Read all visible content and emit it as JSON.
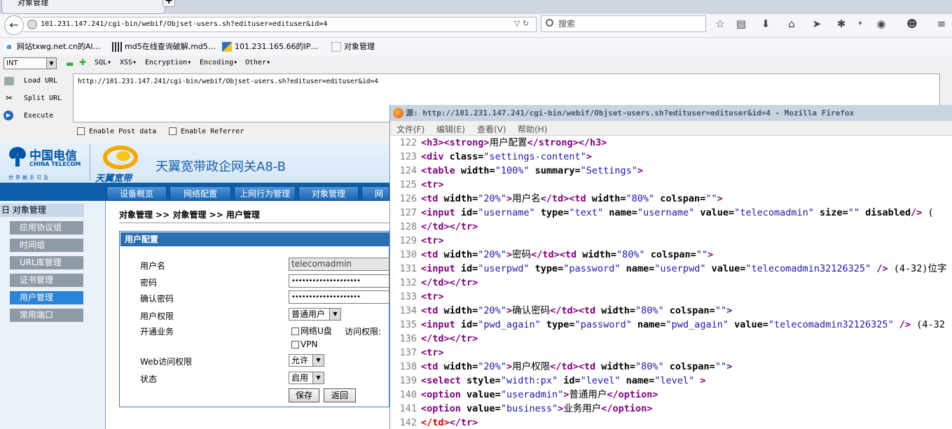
{
  "browser": {
    "tab_title": "对象管理",
    "url": "101.231.147.241/cgi-bin/webif/Objset-users.sh?edituser=edituser&id=4",
    "search_placeholder": "搜索",
    "bookmarks": [
      {
        "label": "网站txwg.net.cn的Al…"
      },
      {
        "label": "md5在线查询破解,md5…"
      },
      {
        "label": "101.231.165.66的IP…"
      },
      {
        "label": "对象管理"
      }
    ]
  },
  "hackbar": {
    "type_value": "INT",
    "menus": [
      "SQL▾",
      "XSS▾",
      "Encryption▾",
      "Encoding▾",
      "Other▾"
    ],
    "load_url": "Load URL",
    "split_url": "Split URL",
    "execute": "Execute",
    "url_value": "http://101.231.147.241/cgi-bin/webif/Objset-users.sh?edituser=edituser&id=4",
    "enable_post": "Enable Post data",
    "enable_referrer": "Enable Referrer"
  },
  "webpage": {
    "brand_cn": "中国电信",
    "brand_en": "CHINA TELECOM",
    "slogan": "世界触手可及",
    "ty_brand": "天翼宽带",
    "product_title": "天翼宽带政企网关A8-B",
    "nav_tabs": [
      "设备概览",
      "网络配置",
      "上网行为管理",
      "对象管理",
      "网络"
    ],
    "menu_head": "日 对象管理",
    "menu_items": [
      "应用协议组",
      "时间组",
      "URL库管理",
      "证书管理",
      "用户管理",
      "常用端口"
    ],
    "breadcrumb": "对象管理 >> 对象管理 >> 用户管理",
    "panel_title": "用户配置",
    "form": {
      "username_label": "用户名",
      "username_value": "telecomadmin",
      "password_label": "密码",
      "password_value": "••••••••••••••••••••",
      "confirm_label": "确认密码",
      "confirm_value": "••••••••••••••••••••",
      "level_label": "用户权限",
      "level_value": "普通用户",
      "service_label": "开通业务",
      "service_usb": "网络U盘",
      "access_label": "访问权限:",
      "service_vpn": "VPN",
      "web_label": "Web访问权限",
      "web_value": "允许",
      "status_label": "状态",
      "status_value": "启用",
      "save": "保存",
      "back": "返回"
    }
  },
  "viewsource": {
    "title": "源: http://101.231.147.241/cgi-bin/webif/Objset-users.sh?edituser=edituser&id=4 - Mozilla Firefox",
    "menus": [
      "文件(F)",
      "编辑(E)",
      "查看(V)",
      "帮助(H)"
    ],
    "lines": [
      {
        "n": "122",
        "code": [
          [
            "t",
            "<h3>"
          ],
          [
            "t",
            "<strong>"
          ],
          [
            "tx",
            "用户配置"
          ],
          [
            "t",
            "</strong>"
          ],
          [
            "t",
            "</h3>"
          ]
        ]
      },
      {
        "n": "123",
        "code": [
          [
            "t",
            "<div "
          ],
          [
            "an",
            "class="
          ],
          [
            "av",
            "\"settings-content\""
          ],
          [
            "t",
            ">"
          ]
        ]
      },
      {
        "n": "124",
        "code": [
          [
            "t",
            "<table "
          ],
          [
            "an",
            "width="
          ],
          [
            "av",
            "\"100%\""
          ],
          [
            "an",
            " summary="
          ],
          [
            "av",
            "\"Settings\""
          ],
          [
            "t",
            ">"
          ]
        ]
      },
      {
        "n": "125",
        "code": [
          [
            "t",
            "<tr>"
          ]
        ]
      },
      {
        "n": "126",
        "code": [
          [
            "t",
            "<td "
          ],
          [
            "an",
            "width="
          ],
          [
            "av",
            "\"20%\""
          ],
          [
            "t",
            ">"
          ],
          [
            "tx",
            "用户名"
          ],
          [
            "t",
            "</td>"
          ],
          [
            "t",
            "<td "
          ],
          [
            "an",
            "width="
          ],
          [
            "av",
            "\"80%\""
          ],
          [
            "an",
            " colspan="
          ],
          [
            "av",
            "\"\""
          ],
          [
            "t",
            ">"
          ]
        ]
      },
      {
        "n": "127",
        "code": [
          [
            "t",
            "<input "
          ],
          [
            "an",
            "id="
          ],
          [
            "av",
            "\"username\""
          ],
          [
            "an",
            " type="
          ],
          [
            "av",
            "\"text\""
          ],
          [
            "an",
            " name="
          ],
          [
            "av",
            "\"username\""
          ],
          [
            "an",
            " value="
          ],
          [
            "av",
            "\"telecomadmin\""
          ],
          [
            "an",
            " size="
          ],
          [
            "av",
            "\"\""
          ],
          [
            "an",
            " disabled"
          ],
          [
            "t",
            "/>"
          ],
          [
            "tx",
            " ("
          ]
        ]
      },
      {
        "n": "128",
        "code": [
          [
            "t",
            "</td>"
          ],
          [
            "t",
            "</tr>"
          ]
        ]
      },
      {
        "n": "129",
        "code": [
          [
            "t",
            "<tr>"
          ]
        ]
      },
      {
        "n": "130",
        "code": [
          [
            "t",
            "<td "
          ],
          [
            "an",
            "width="
          ],
          [
            "av",
            "\"20%\""
          ],
          [
            "t",
            ">"
          ],
          [
            "tx",
            "密码"
          ],
          [
            "t",
            "</td>"
          ],
          [
            "t",
            "<td "
          ],
          [
            "an",
            "width="
          ],
          [
            "av",
            "\"80%\""
          ],
          [
            "an",
            " colspan="
          ],
          [
            "av",
            "\"\""
          ],
          [
            "t",
            ">"
          ]
        ]
      },
      {
        "n": "131",
        "code": [
          [
            "t",
            "<input "
          ],
          [
            "an",
            "id="
          ],
          [
            "av",
            "\"userpwd\""
          ],
          [
            "an",
            " type="
          ],
          [
            "av",
            "\"password\""
          ],
          [
            "an",
            " name="
          ],
          [
            "av",
            "\"userpwd\""
          ],
          [
            "an",
            " value="
          ],
          [
            "av",
            "\"telecomadmin32126325\""
          ],
          [
            "t",
            " />"
          ],
          [
            "tx",
            " (4-32)位字"
          ]
        ]
      },
      {
        "n": "132",
        "code": [
          [
            "t",
            "</td>"
          ],
          [
            "t",
            "</tr>"
          ]
        ]
      },
      {
        "n": "133",
        "code": [
          [
            "t",
            "<tr>"
          ]
        ]
      },
      {
        "n": "134",
        "code": [
          [
            "t",
            "<td "
          ],
          [
            "an",
            "width="
          ],
          [
            "av",
            "\"20%\""
          ],
          [
            "t",
            ">"
          ],
          [
            "tx",
            "确认密码"
          ],
          [
            "t",
            "</td>"
          ],
          [
            "t",
            "<td "
          ],
          [
            "an",
            "width="
          ],
          [
            "av",
            "\"80%\""
          ],
          [
            "an",
            " colspan="
          ],
          [
            "av",
            "\"\""
          ],
          [
            "t",
            ">"
          ]
        ]
      },
      {
        "n": "135",
        "code": [
          [
            "t",
            "<input "
          ],
          [
            "an",
            "id="
          ],
          [
            "av",
            "\"pwd_again\""
          ],
          [
            "an",
            " type="
          ],
          [
            "av",
            "\"password\""
          ],
          [
            "an",
            " name="
          ],
          [
            "av",
            "\"pwd_again\""
          ],
          [
            "an",
            " value="
          ],
          [
            "av",
            "\"telecomadmin32126325\""
          ],
          [
            "t",
            " />"
          ],
          [
            "tx",
            " (4-32"
          ]
        ]
      },
      {
        "n": "136",
        "code": [
          [
            "t",
            "</td>"
          ],
          [
            "t",
            "</tr>"
          ]
        ]
      },
      {
        "n": "137",
        "code": [
          [
            "t",
            "<tr>"
          ]
        ]
      },
      {
        "n": "138",
        "code": [
          [
            "t",
            "<td "
          ],
          [
            "an",
            "width="
          ],
          [
            "av",
            "\"20%\""
          ],
          [
            "t",
            ">"
          ],
          [
            "tx",
            "用户权限"
          ],
          [
            "t",
            "</td>"
          ],
          [
            "t",
            "<td "
          ],
          [
            "an",
            "width="
          ],
          [
            "av",
            "\"80%\""
          ],
          [
            "an",
            " colspan="
          ],
          [
            "av",
            "\"\""
          ],
          [
            "t",
            ">"
          ]
        ]
      },
      {
        "n": "139",
        "code": [
          [
            "t",
            "<select "
          ],
          [
            "an",
            "style="
          ],
          [
            "av",
            "\"width:px\""
          ],
          [
            "an",
            " id="
          ],
          [
            "av",
            "\"level\""
          ],
          [
            "an",
            " name="
          ],
          [
            "av",
            "\"level\""
          ],
          [
            "t",
            " >"
          ]
        ]
      },
      {
        "n": "140",
        "code": [
          [
            "t",
            "<option "
          ],
          [
            "an",
            " value="
          ],
          [
            "av",
            "\"useradmin\""
          ],
          [
            "t",
            ">"
          ],
          [
            "tx",
            "普通用户"
          ],
          [
            "t",
            "</option>"
          ]
        ]
      },
      {
        "n": "141",
        "code": [
          [
            "t",
            "<option "
          ],
          [
            "an",
            " value="
          ],
          [
            "av",
            "\"business\""
          ],
          [
            "t",
            ">"
          ],
          [
            "tx",
            "业务用户"
          ],
          [
            "t",
            "</option>"
          ]
        ]
      },
      {
        "n": "142",
        "code": [
          [
            "er",
            "</td>"
          ],
          [
            "t",
            "</tr>"
          ]
        ]
      }
    ]
  }
}
